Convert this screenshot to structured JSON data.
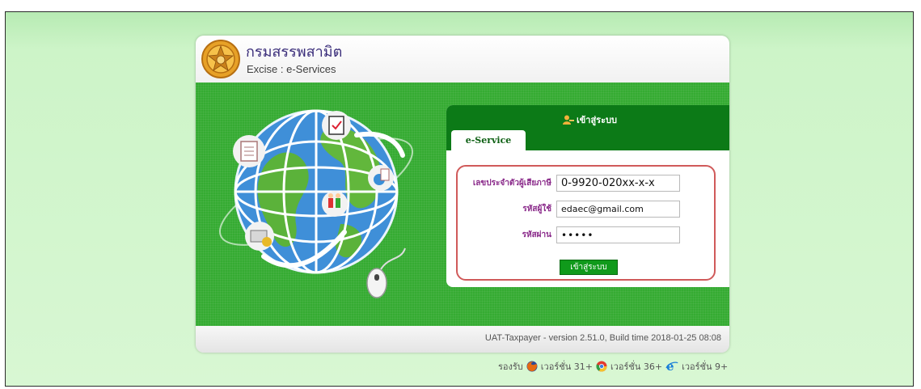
{
  "header": {
    "org_name_th": "กรมสรรพสามิต",
    "org_name_en": "Excise : e-Services"
  },
  "login": {
    "title": "เข้าสู่ระบบ",
    "tab_label": "e-Service",
    "taxpayer_id_label": "เลขประจำตัวผู้เสียภาษี",
    "taxpayer_id_value": "0-9920-020xx-x-x",
    "username_label": "รหัสผู้ใช้",
    "username_value": "edaec@gmail.com",
    "password_label": "รหัสผ่าน",
    "password_value": "•••••",
    "submit_label": "เข้าสู่ระบบ"
  },
  "footer": {
    "version_text": "UAT-Taxpayer - version 2.51.0, Build time 2018-01-25 08:08"
  },
  "support": {
    "label": "รองรับ",
    "browsers": [
      {
        "icon": "firefox-icon",
        "text": "เวอร์ชั่น 31+"
      },
      {
        "icon": "chrome-icon",
        "text": "เวอร์ชั่น 36+"
      },
      {
        "icon": "ie-icon",
        "text": "เวอร์ชั่น 9+"
      }
    ]
  },
  "colors": {
    "brand_green": "#35ab32",
    "panel_green": "#0c7a17",
    "highlight_red": "#d05a5a",
    "page_bg": "#cdf4c8"
  }
}
